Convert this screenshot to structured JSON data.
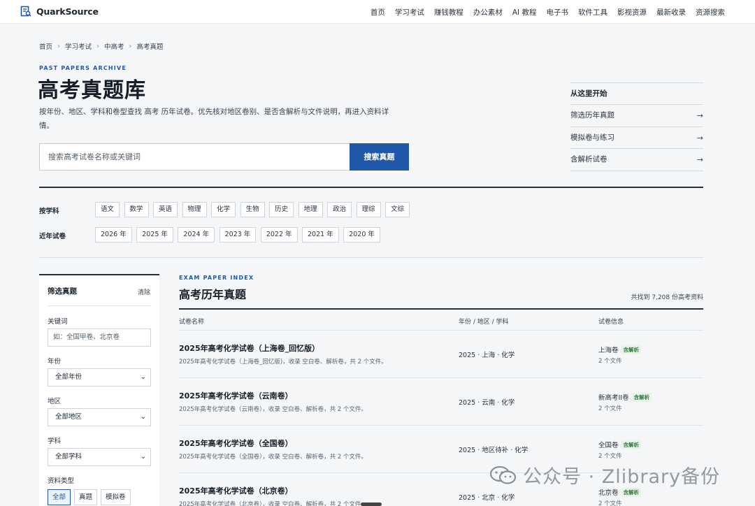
{
  "header": {
    "brand": "QuarkSource",
    "nav": [
      "首页",
      "学习考试",
      "赚钱教程",
      "办公素材",
      "AI 教程",
      "电子书",
      "软件工具",
      "影视资源",
      "最新收录",
      "资源搜索"
    ]
  },
  "breadcrumb": [
    "首页",
    "学习考试",
    "中高考",
    "高考真题"
  ],
  "hero": {
    "eyebrow": "PAST PAPERS ARCHIVE",
    "title": "高考真题库",
    "intro": "按年份、地区、学科和卷型查找 高考 历年试卷。优先核对地区卷别、是否含解析与文件说明，再进入资料详情。",
    "search_placeholder": "搜索高考试卷名称或关键词",
    "search_button": "搜索真题"
  },
  "quick": {
    "title": "从这里开始",
    "items": [
      "筛选历年真题",
      "模拟卷与练习",
      "含解析试卷"
    ]
  },
  "subjects": {
    "label": "按学科",
    "items": [
      "语文",
      "数学",
      "英语",
      "物理",
      "化学",
      "生物",
      "历史",
      "地理",
      "政治",
      "理综",
      "文综"
    ]
  },
  "years": {
    "label": "近年试卷",
    "items": [
      "2026 年",
      "2025 年",
      "2024 年",
      "2023 年",
      "2022 年",
      "2021 年",
      "2020 年"
    ]
  },
  "filter": {
    "title": "筛选真题",
    "clear": "清除",
    "keyword_label": "关键词",
    "keyword_placeholder": "如：全国甲卷、北京卷",
    "year_label": "年份",
    "year_value": "全部年份",
    "region_label": "地区",
    "region_value": "全部地区",
    "subject_label": "学科",
    "subject_value": "全部学科",
    "type_label": "资料类型",
    "types": [
      "全部",
      "真题",
      "模拟卷"
    ]
  },
  "index": {
    "eyebrow": "EXAM PAPER INDEX",
    "title": "高考历年真题",
    "count": "共找到 7,208 份高考资料",
    "columns": [
      "试卷名称",
      "年份 / 地区 / 学科",
      "试卷信息"
    ],
    "rows": [
      {
        "title": "2025年高考化学试卷（上海卷_回忆版）",
        "desc": "2025年高考化学试卷（上海卷_回忆版)，收录 空白卷、解析卷，共 2 个文件。",
        "meta": "2025 · 上海 · 化学",
        "info": "上海卷",
        "badge": "含解析",
        "files": "2 个文件"
      },
      {
        "title": "2025年高考化学试卷（云南卷）",
        "desc": "2025年高考化学试卷（云南卷），收录 空白卷、解析卷，共 2 个文件。",
        "meta": "2025 · 云南 · 化学",
        "info": "新高考II卷",
        "badge": "含解析",
        "files": "2 个文件"
      },
      {
        "title": "2025年高考化学试卷（全国卷）",
        "desc": "2025年高考化学试卷（全国卷），收录 空白卷、解析卷，共 2 个文件。",
        "meta": "2025 · 地区待补 · 化学",
        "info": "全国卷",
        "badge": "含解析",
        "files": "2 个文件"
      },
      {
        "title": "2025年高考化学试卷（北京卷）",
        "desc": "2025年高考化学试卷（北京卷），收录 空白卷、解析卷，共 2 个文件。",
        "meta": "2025 · 北京 · 化学",
        "info": "北京卷",
        "badge": "含解析",
        "files": "2 个文件"
      }
    ]
  },
  "watermark": "公众号 · Zlibrary备份"
}
